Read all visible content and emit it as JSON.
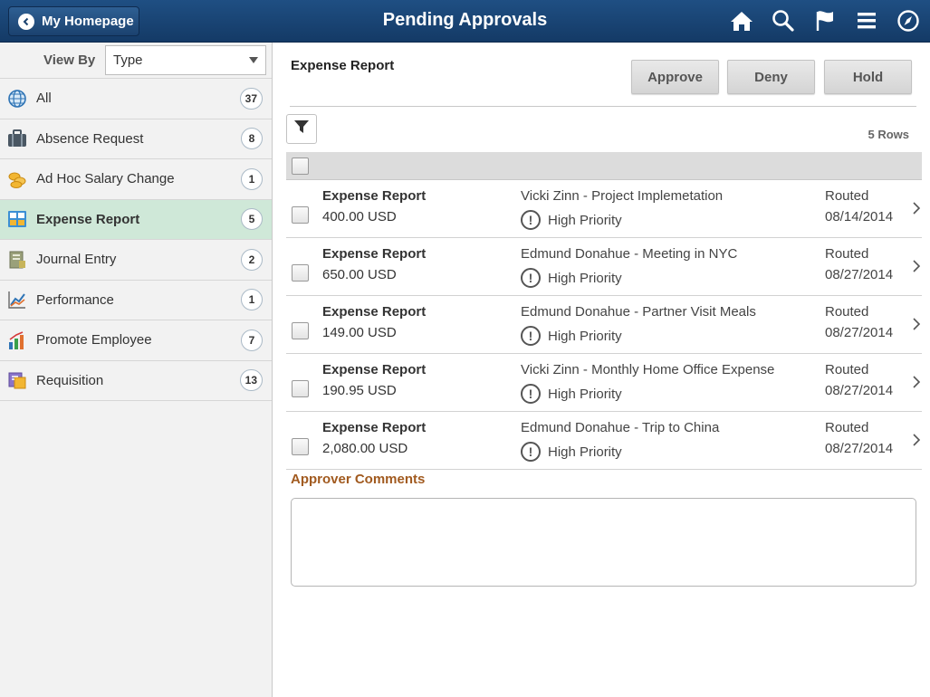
{
  "header": {
    "back_label": "My Homepage",
    "title": "Pending Approvals",
    "icons": [
      "home-icon",
      "search-icon",
      "flag-icon",
      "menu-icon",
      "navbar-icon"
    ]
  },
  "sidebar": {
    "view_by_label": "View By",
    "view_by_value": "Type",
    "items": [
      {
        "label": "All",
        "count": "37",
        "icon": "globe-icon"
      },
      {
        "label": "Absence Request",
        "count": "8",
        "icon": "suitcase-icon"
      },
      {
        "label": "Ad Hoc Salary Change",
        "count": "1",
        "icon": "coins-icon"
      },
      {
        "label": "Expense Report",
        "count": "5",
        "icon": "expense-icon",
        "active": true
      },
      {
        "label": "Journal Entry",
        "count": "2",
        "icon": "ledger-icon"
      },
      {
        "label": "Performance",
        "count": "1",
        "icon": "line-chart-icon"
      },
      {
        "label": "Promote Employee",
        "count": "7",
        "icon": "bar-chart-icon"
      },
      {
        "label": "Requisition",
        "count": "13",
        "icon": "requisition-icon"
      }
    ]
  },
  "main": {
    "title": "Expense Report",
    "buttons": {
      "approve": "Approve",
      "deny": "Deny",
      "hold": "Hold"
    },
    "row_count": "5 Rows",
    "rows": [
      {
        "type": "Expense Report",
        "amount": "400.00 USD",
        "description": "Vicki Zinn - Project Implemetation",
        "priority": "High Priority",
        "status": "Routed",
        "date": "08/14/2014"
      },
      {
        "type": "Expense Report",
        "amount": "650.00 USD",
        "description": "Edmund Donahue - Meeting in NYC",
        "priority": "High Priority",
        "status": "Routed",
        "date": "08/27/2014"
      },
      {
        "type": "Expense Report",
        "amount": "149.00 USD",
        "description": "Edmund Donahue - Partner Visit Meals",
        "priority": "High Priority",
        "status": "Routed",
        "date": "08/27/2014"
      },
      {
        "type": "Expense Report",
        "amount": "190.95 USD",
        "description": "Vicki Zinn - Monthly Home Office Expense",
        "priority": "High Priority",
        "status": "Routed",
        "date": "08/27/2014"
      },
      {
        "type": "Expense Report",
        "amount": "2,080.00 USD",
        "description": "Edmund Donahue - Trip to China",
        "priority": "High Priority",
        "status": "Routed",
        "date": "08/27/2014"
      }
    ],
    "comments_label": "Approver Comments",
    "comments_value": ""
  },
  "colors": {
    "banner": "#1a4677",
    "active_item": "#cfe8d8",
    "comments_label": "#a15a1f"
  }
}
